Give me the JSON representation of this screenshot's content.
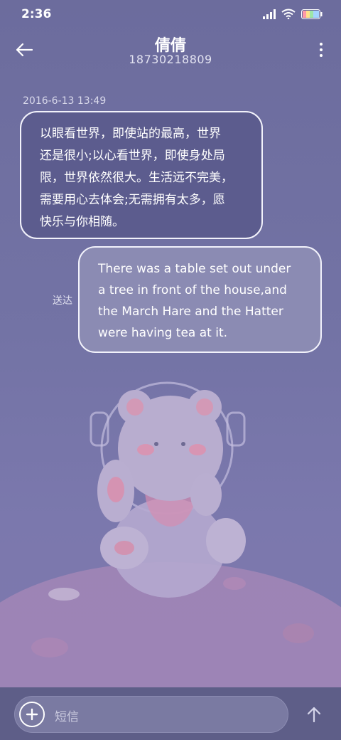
{
  "status": {
    "time": "2:36"
  },
  "header": {
    "contact_name": "倩倩",
    "phone_number": "18730218809"
  },
  "conversation": {
    "timestamp": "2016-6-13 13:49",
    "incoming_lines": [
      "以眼看世界，即使站的最高，世界",
      "还是很小;以心看世界，即使身处局",
      "限，世界依然很大。生活远不完美，",
      "需要用心去体会;无需拥有太多，愿",
      "快乐与你相随。"
    ],
    "outgoing_lines": [
      "There was a table set out under",
      "a tree in front of the house,and",
      "the March Hare and the Hatter",
      "were having tea at it."
    ],
    "sent_status": "送达"
  },
  "composer": {
    "placeholder": "短信"
  },
  "icons": [
    "back-arrow-icon",
    "more-vert-icon",
    "signal-icon",
    "wifi-icon",
    "battery-icon",
    "plus-icon",
    "send-arrow-icon"
  ],
  "colors": {
    "background": "#6f6fa0",
    "incoming_bubble": "#5c5c8e",
    "outgoing_bubble": "#8b8bb3",
    "bubble_border": "#f2f2fb"
  }
}
